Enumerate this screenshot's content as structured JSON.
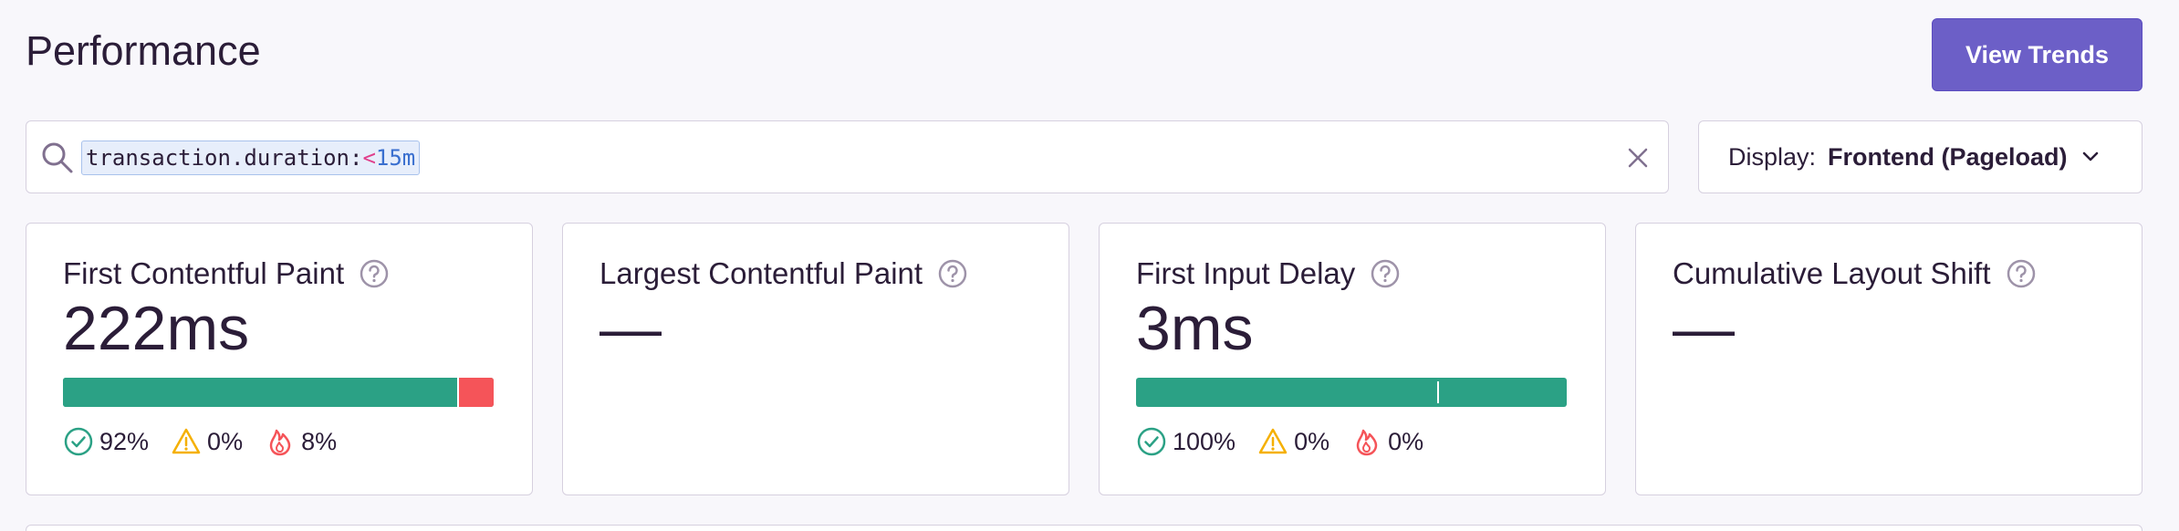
{
  "page": {
    "title": "Performance",
    "view_trends_label": "View Trends"
  },
  "search": {
    "token_key": "transaction.duration:",
    "token_op": "<",
    "token_value": "15m"
  },
  "display": {
    "label": "Display:",
    "value": "Frontend (Pageload)"
  },
  "colors": {
    "good": "#2ba185",
    "meh": "#f5b000",
    "poor": "#f55459",
    "accent": "#6c5fc7"
  },
  "cards": [
    {
      "title": "First Contentful Paint",
      "value": "222ms",
      "bar": {
        "good": 0.92,
        "meh": 0.0,
        "poor": 0.08
      },
      "stats": {
        "good": "92%",
        "meh": "0%",
        "poor": "8%"
      }
    },
    {
      "title": "Largest Contentful Paint",
      "value": "—"
    },
    {
      "title": "First Input Delay",
      "value": "3ms",
      "bar": {
        "good": 1.0,
        "meh": 0.0,
        "poor": 0.0,
        "marker": 0.7
      },
      "stats": {
        "good": "100%",
        "meh": "0%",
        "poor": "0%"
      }
    },
    {
      "title": "Cumulative Layout Shift",
      "value": "—"
    }
  ]
}
